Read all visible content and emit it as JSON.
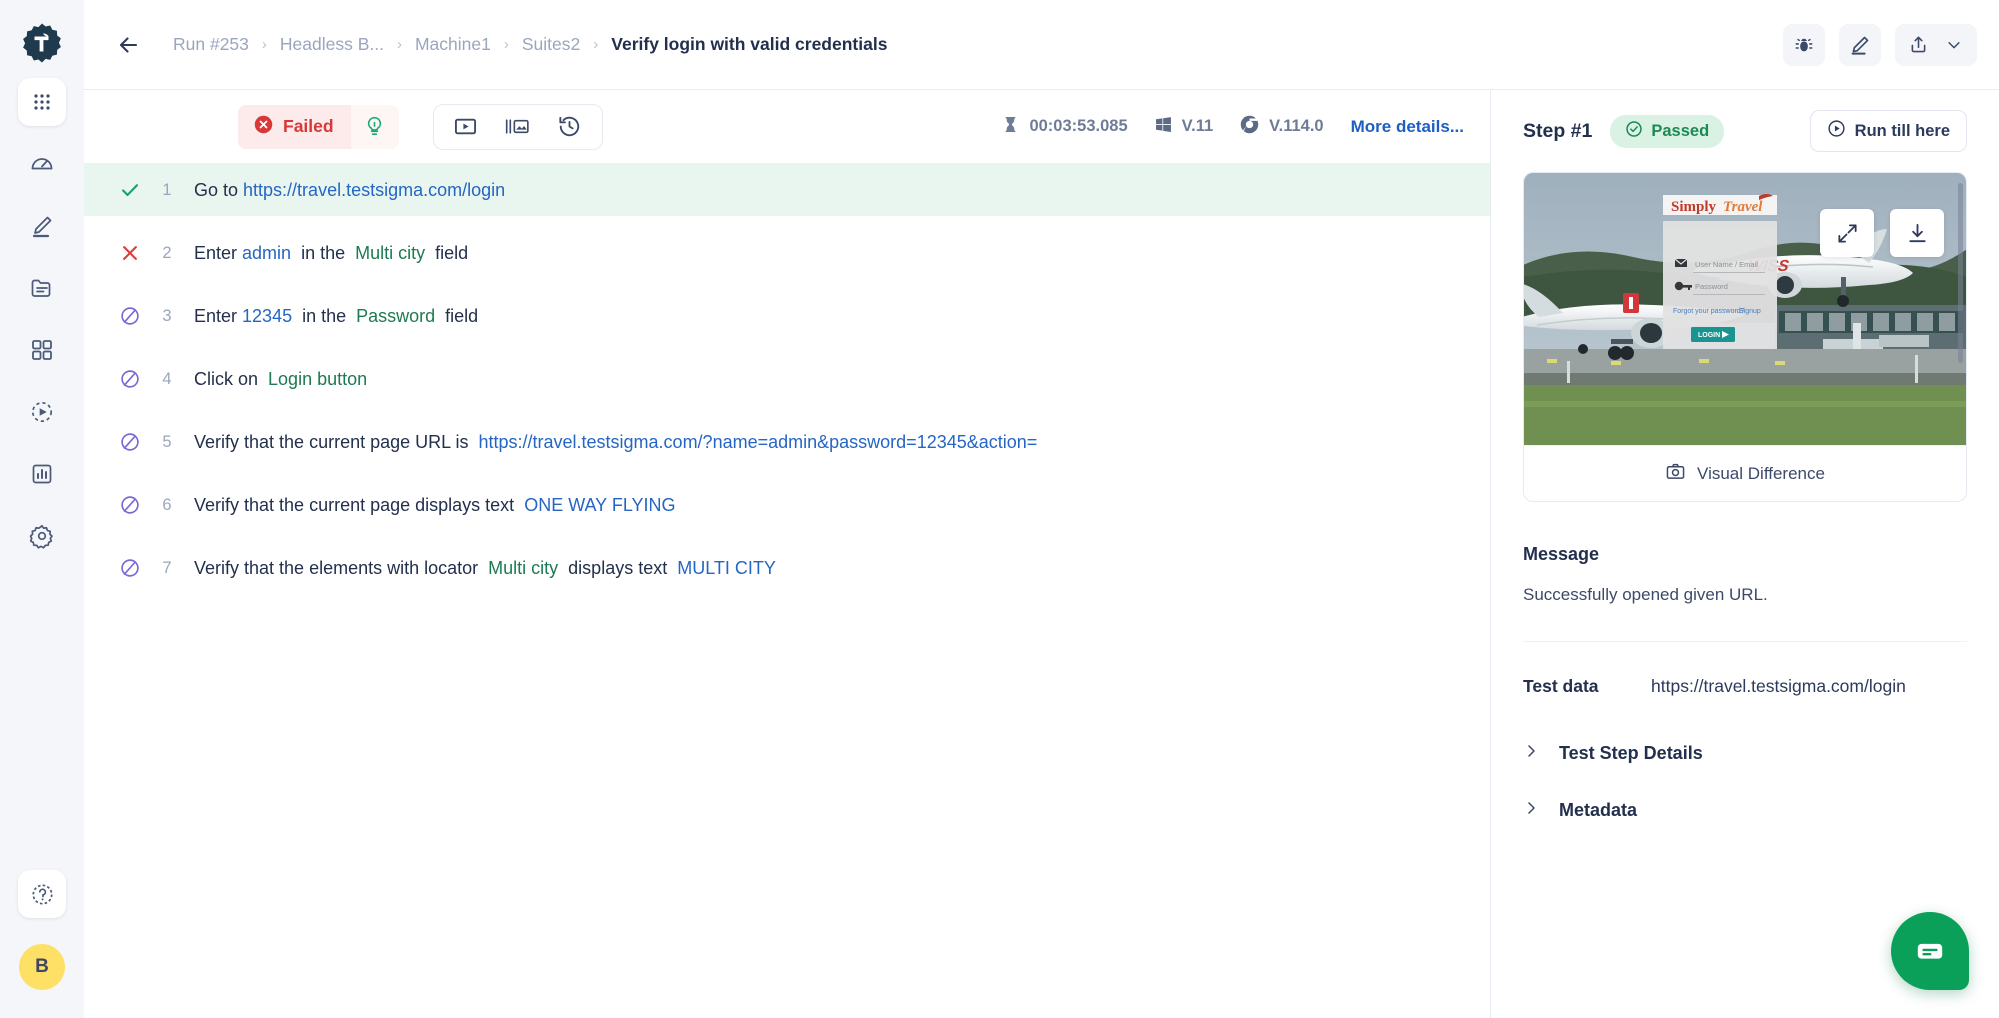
{
  "sidebar": {
    "logo_icon": "testsigma-logo-icon",
    "items": [
      {
        "icon": "apps-grid-icon",
        "name": "apps",
        "active": true
      },
      {
        "icon": "speedometer-dashboard-icon",
        "name": "dashboard",
        "active": false
      },
      {
        "icon": "pencil-create-icon",
        "name": "create-tests",
        "active": false
      },
      {
        "icon": "folder-icon",
        "name": "test-cases",
        "active": false
      },
      {
        "icon": "grid-squares-icon",
        "name": "test-suites",
        "active": false
      },
      {
        "icon": "play-circle-dashed-icon",
        "name": "test-plans",
        "active": false
      },
      {
        "icon": "bar-chart-icon",
        "name": "reports",
        "active": false
      },
      {
        "icon": "gear-settings-icon",
        "name": "settings",
        "active": false
      }
    ],
    "help_icon": "question-circle-icon",
    "avatar_initial": "B"
  },
  "header": {
    "back_icon": "arrow-left-icon",
    "breadcrumbs": [
      {
        "label": "Run #253",
        "current": false
      },
      {
        "label": "Headless B...",
        "current": false
      },
      {
        "label": "Machine1",
        "current": false
      },
      {
        "label": "Suites2",
        "current": false
      },
      {
        "label": "Verify login with valid credentials",
        "current": true
      }
    ],
    "separator": "›",
    "actions": [
      {
        "icon": "bug-icon",
        "name": "report-bug-button"
      },
      {
        "icon": "pencil-edit-icon",
        "name": "edit-button"
      }
    ],
    "share": {
      "icon": "share-upload-icon",
      "chevron": "chevron-down-icon"
    }
  },
  "toolbar": {
    "status": {
      "label": "Failed",
      "icon": "error-circle-icon",
      "color": "#d93838",
      "bg": "#fdeaea"
    },
    "bulb": {
      "icon": "lightbulb-icon",
      "color": "#19a974"
    },
    "media_buttons": [
      {
        "icon": "video-play-icon",
        "name": "view-recording-button"
      },
      {
        "icon": "screenshots-compare-icon",
        "name": "view-screenshots-button"
      },
      {
        "icon": "history-clock-icon",
        "name": "view-history-button"
      }
    ],
    "duration": {
      "icon": "hourglass-icon",
      "value": "00:03:53.085"
    },
    "os": {
      "icon": "windows-icon",
      "value": "V.11"
    },
    "browser": {
      "icon": "chrome-icon",
      "value": "V.114.0"
    },
    "more_details": "More details..."
  },
  "steps": [
    {
      "num": "1",
      "status": "passed",
      "status_icon": "check-icon",
      "selected": true,
      "tokens": [
        {
          "t": "Go to ",
          "k": "plain"
        },
        {
          "t": "https://travel.testsigma.com/login",
          "k": "link"
        }
      ]
    },
    {
      "num": "2",
      "status": "failed",
      "status_icon": "cross-icon",
      "selected": false,
      "tokens": [
        {
          "t": "Enter ",
          "k": "plain"
        },
        {
          "t": "admin",
          "k": "value"
        },
        {
          "t": "  in the  ",
          "k": "plain"
        },
        {
          "t": "Multi city",
          "k": "elem"
        },
        {
          "t": "  field",
          "k": "plain"
        }
      ]
    },
    {
      "num": "3",
      "status": "not-run",
      "status_icon": "blocked-circle-icon",
      "selected": false,
      "tokens": [
        {
          "t": "Enter ",
          "k": "plain"
        },
        {
          "t": "12345",
          "k": "value"
        },
        {
          "t": "  in the  ",
          "k": "plain"
        },
        {
          "t": "Password",
          "k": "elem"
        },
        {
          "t": "  field",
          "k": "plain"
        }
      ]
    },
    {
      "num": "4",
      "status": "not-run",
      "status_icon": "blocked-circle-icon",
      "selected": false,
      "tokens": [
        {
          "t": "Click on  ",
          "k": "plain"
        },
        {
          "t": "Login button",
          "k": "elem"
        }
      ]
    },
    {
      "num": "5",
      "status": "not-run",
      "status_icon": "blocked-circle-icon",
      "selected": false,
      "tokens": [
        {
          "t": "Verify that the current page URL is  ",
          "k": "plain"
        },
        {
          "t": "https://travel.testsigma.com/?name=admin&password=12345&action=",
          "k": "link"
        }
      ]
    },
    {
      "num": "6",
      "status": "not-run",
      "status_icon": "blocked-circle-icon",
      "selected": false,
      "tokens": [
        {
          "t": "Verify that the current page displays text  ",
          "k": "plain"
        },
        {
          "t": "ONE WAY FLYING",
          "k": "value"
        }
      ]
    },
    {
      "num": "7",
      "status": "not-run",
      "status_icon": "blocked-circle-icon",
      "selected": false,
      "tokens": [
        {
          "t": "Verify that the elements with locator  ",
          "k": "plain"
        },
        {
          "t": "Multi city",
          "k": "elem"
        },
        {
          "t": "  displays text  ",
          "k": "plain"
        },
        {
          "t": "MULTI CITY",
          "k": "value"
        }
      ]
    }
  ],
  "detail": {
    "step_title": "Step #1",
    "status": {
      "label": "Passed",
      "icon": "check-circle-icon",
      "color": "#1d8a55",
      "bg": "#d9f2e3"
    },
    "run_till_here": {
      "label": "Run till here",
      "icon": "play-circle-icon"
    },
    "screenshot": {
      "expand_icon": "expand-arrows-icon",
      "download_icon": "download-icon",
      "page": {
        "logo_text_1": "Simply",
        "logo_text_2": "Travel",
        "username_placeholder": "User Name / Email",
        "password_placeholder": "Password",
        "forgot_link": "Forgot your password?",
        "signup_link": "Signup",
        "login_button": "LOGIN"
      }
    },
    "visual_difference": {
      "label": "Visual Difference",
      "icon": "camera-icon"
    },
    "message_label": "Message",
    "message_body": "Successfully opened given URL.",
    "test_data_label": "Test data",
    "test_data_value": "https://travel.testsigma.com/login",
    "accordions": [
      {
        "label": "Test Step Details",
        "icon": "chevron-right-icon"
      },
      {
        "label": "Metadata",
        "icon": "chevron-right-icon"
      }
    ]
  },
  "chat": {
    "icon": "chat-bubble-icon",
    "color": "#0aa05a"
  }
}
